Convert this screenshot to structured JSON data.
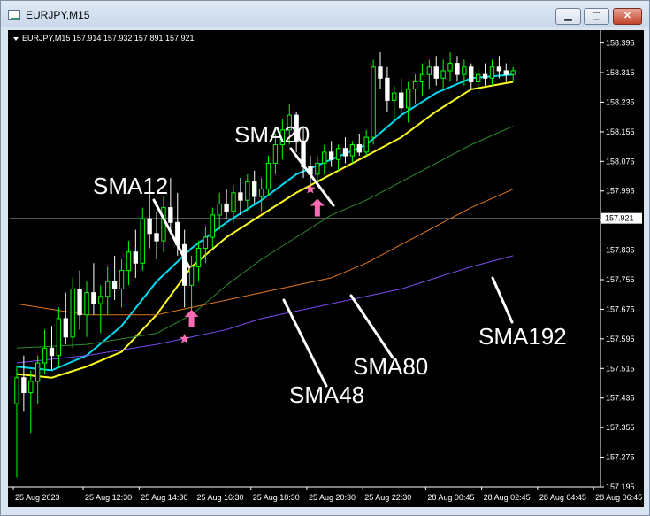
{
  "window": {
    "title": "EURJPY,M15",
    "buttons": {
      "minimize": "▁",
      "maximize": "▢",
      "close": "✕"
    }
  },
  "chart_header": "EURJPY,M15  157.914 157.932 157.891 157.921",
  "colors": {
    "background": "#000000",
    "bull_candle": "#00ff00",
    "bear_candle": "#ffffff",
    "sma12": "#00d8f0",
    "sma20": "#ffff20",
    "sma48": "#2e8b2e",
    "sma80": "#e07820",
    "sma192": "#7a4cf0",
    "arrow": "#ff6ab4",
    "annotation": "#ffffff"
  },
  "chart_data": {
    "type": "candlestick",
    "symbol": "EURJPY",
    "timeframe": "M15",
    "ohlc_current": {
      "open": 157.914,
      "high": 157.932,
      "low": 157.891,
      "close": 157.921
    },
    "current_price_label": "157.921",
    "ylim": [
      157.195,
      158.43
    ],
    "y_ticks": [
      157.195,
      157.275,
      157.355,
      157.435,
      157.515,
      157.595,
      157.675,
      157.755,
      157.835,
      157.915,
      157.995,
      158.075,
      158.155,
      158.235,
      158.315,
      158.395
    ],
    "x_ticks": [
      {
        "label": "25 Aug 2023",
        "bar": 0
      },
      {
        "label": "25 Aug 12:30",
        "bar": 10
      },
      {
        "label": "25 Aug 14:30",
        "bar": 18
      },
      {
        "label": "25 Aug 16:30",
        "bar": 26
      },
      {
        "label": "25 Aug 18:30",
        "bar": 34
      },
      {
        "label": "25 Aug 20:30",
        "bar": 42
      },
      {
        "label": "25 Aug 22:30",
        "bar": 50
      },
      {
        "label": "28 Aug 00:45",
        "bar": 59
      },
      {
        "label": "28 Aug 02:45",
        "bar": 67
      },
      {
        "label": "28 Aug 04:45",
        "bar": 75
      },
      {
        "label": "28 Aug 06:45",
        "bar": 83
      }
    ],
    "candles": [
      [
        157.42,
        157.52,
        157.22,
        157.49
      ],
      [
        157.49,
        157.55,
        157.4,
        157.45
      ],
      [
        157.45,
        157.51,
        157.34,
        157.48
      ],
      [
        157.48,
        157.55,
        157.42,
        157.53
      ],
      [
        157.53,
        157.62,
        157.5,
        157.57
      ],
      [
        157.57,
        157.63,
        157.51,
        157.55
      ],
      [
        157.55,
        157.68,
        157.52,
        157.65
      ],
      [
        157.65,
        157.72,
        157.58,
        157.6
      ],
      [
        157.6,
        157.76,
        157.57,
        157.73
      ],
      [
        157.73,
        157.78,
        157.62,
        157.66
      ],
      [
        157.66,
        157.75,
        157.6,
        157.72
      ],
      [
        157.72,
        157.8,
        157.66,
        157.69
      ],
      [
        157.69,
        157.74,
        157.61,
        157.71
      ],
      [
        157.71,
        157.79,
        157.66,
        157.75
      ],
      [
        157.75,
        157.82,
        157.7,
        157.73
      ],
      [
        157.73,
        157.81,
        157.68,
        157.78
      ],
      [
        157.78,
        157.86,
        157.74,
        157.83
      ],
      [
        157.83,
        157.89,
        157.76,
        157.8
      ],
      [
        157.8,
        157.95,
        157.78,
        157.92
      ],
      [
        157.92,
        158.0,
        157.84,
        157.88
      ],
      [
        157.88,
        157.94,
        157.81,
        157.86
      ],
      [
        157.86,
        157.98,
        157.83,
        157.95
      ],
      [
        157.95,
        158.03,
        157.88,
        157.91
      ],
      [
        157.91,
        157.99,
        157.82,
        157.85
      ],
      [
        157.85,
        157.89,
        157.68,
        157.74
      ],
      [
        157.74,
        157.82,
        157.67,
        157.79
      ],
      [
        157.79,
        157.86,
        157.75,
        157.84
      ],
      [
        157.84,
        157.9,
        157.8,
        157.87
      ],
      [
        157.87,
        157.95,
        157.84,
        157.93
      ],
      [
        157.93,
        157.99,
        157.89,
        157.96
      ],
      [
        157.96,
        158.0,
        157.92,
        157.94
      ],
      [
        157.94,
        158.01,
        157.91,
        157.99
      ],
      [
        157.99,
        158.03,
        157.93,
        157.97
      ],
      [
        157.97,
        158.04,
        157.94,
        158.02
      ],
      [
        158.02,
        158.05,
        157.96,
        157.98
      ],
      [
        157.98,
        158.03,
        157.94,
        158.0
      ],
      [
        158.0,
        158.09,
        157.98,
        158.07
      ],
      [
        158.07,
        158.15,
        158.04,
        158.12
      ],
      [
        158.12,
        158.19,
        158.08,
        158.16
      ],
      [
        158.16,
        158.23,
        158.12,
        158.2
      ],
      [
        158.2,
        158.21,
        158.1,
        158.13
      ],
      [
        158.13,
        158.17,
        158.03,
        158.06
      ],
      [
        158.06,
        158.09,
        158.01,
        158.04
      ],
      [
        158.04,
        158.09,
        158.02,
        158.07
      ],
      [
        158.07,
        158.12,
        158.04,
        158.1
      ],
      [
        158.1,
        158.13,
        158.06,
        158.08
      ],
      [
        158.08,
        158.12,
        158.05,
        158.11
      ],
      [
        158.11,
        158.14,
        158.07,
        158.09
      ],
      [
        158.09,
        158.13,
        158.07,
        158.12
      ],
      [
        158.12,
        158.15,
        158.09,
        158.1
      ],
      [
        158.1,
        158.16,
        158.09,
        158.14
      ],
      [
        158.14,
        158.35,
        158.12,
        158.33
      ],
      [
        158.33,
        158.37,
        158.27,
        158.3
      ],
      [
        158.3,
        158.33,
        158.21,
        158.24
      ],
      [
        158.24,
        158.28,
        158.19,
        158.26
      ],
      [
        158.26,
        158.3,
        158.2,
        158.22
      ],
      [
        158.22,
        158.29,
        158.18,
        158.27
      ],
      [
        158.27,
        158.31,
        158.23,
        158.29
      ],
      [
        158.29,
        158.34,
        158.25,
        158.31
      ],
      [
        158.31,
        158.35,
        158.27,
        158.33
      ],
      [
        158.33,
        158.36,
        158.28,
        158.3
      ],
      [
        158.3,
        158.35,
        158.27,
        158.32
      ],
      [
        158.32,
        158.37,
        158.29,
        158.34
      ],
      [
        158.34,
        158.36,
        158.29,
        158.31
      ],
      [
        158.31,
        158.35,
        158.28,
        158.33
      ],
      [
        158.33,
        158.34,
        158.27,
        158.29
      ],
      [
        158.29,
        158.33,
        158.26,
        158.31
      ],
      [
        158.31,
        158.34,
        158.28,
        158.3
      ],
      [
        158.3,
        158.35,
        158.28,
        158.33
      ],
      [
        158.33,
        158.36,
        158.3,
        158.32
      ],
      [
        158.32,
        158.34,
        158.29,
        158.31
      ],
      [
        158.31,
        158.33,
        158.29,
        158.32
      ]
    ],
    "moving_averages": [
      {
        "name": "SMA12",
        "color": "#00d8f0",
        "values": [
          [
            0,
            157.52
          ],
          [
            5,
            157.51
          ],
          [
            10,
            157.55
          ],
          [
            15,
            157.63
          ],
          [
            20,
            157.75
          ],
          [
            25,
            157.84
          ],
          [
            30,
            157.91
          ],
          [
            35,
            157.97
          ],
          [
            40,
            158.04
          ],
          [
            45,
            158.08
          ],
          [
            50,
            158.12
          ],
          [
            55,
            158.2
          ],
          [
            60,
            158.26
          ],
          [
            65,
            158.3
          ],
          [
            71,
            158.31
          ]
        ]
      },
      {
        "name": "SMA20",
        "color": "#ffff20",
        "values": [
          [
            0,
            157.5
          ],
          [
            5,
            157.49
          ],
          [
            10,
            157.52
          ],
          [
            15,
            157.56
          ],
          [
            20,
            157.66
          ],
          [
            25,
            157.79
          ],
          [
            30,
            157.87
          ],
          [
            35,
            157.93
          ],
          [
            40,
            157.99
          ],
          [
            45,
            158.04
          ],
          [
            50,
            158.09
          ],
          [
            55,
            158.14
          ],
          [
            60,
            158.21
          ],
          [
            65,
            158.27
          ],
          [
            71,
            158.29
          ]
        ]
      },
      {
        "name": "SMA48",
        "color": "#2e8b2e",
        "values": [
          [
            0,
            157.57
          ],
          [
            10,
            157.58
          ],
          [
            20,
            157.61
          ],
          [
            25,
            157.66
          ],
          [
            30,
            157.74
          ],
          [
            35,
            157.81
          ],
          [
            40,
            157.87
          ],
          [
            45,
            157.93
          ],
          [
            50,
            157.97
          ],
          [
            55,
            158.02
          ],
          [
            60,
            158.07
          ],
          [
            65,
            158.12
          ],
          [
            71,
            158.17
          ]
        ]
      },
      {
        "name": "SMA80",
        "color": "#e07820",
        "values": [
          [
            0,
            157.69
          ],
          [
            10,
            157.66
          ],
          [
            20,
            157.66
          ],
          [
            25,
            157.68
          ],
          [
            30,
            157.7
          ],
          [
            35,
            157.72
          ],
          [
            40,
            157.74
          ],
          [
            45,
            157.76
          ],
          [
            50,
            157.8
          ],
          [
            55,
            157.85
          ],
          [
            60,
            157.9
          ],
          [
            65,
            157.95
          ],
          [
            71,
            158.0
          ]
        ]
      },
      {
        "name": "SMA192",
        "color": "#7a4cf0",
        "values": [
          [
            0,
            157.53
          ],
          [
            10,
            157.55
          ],
          [
            20,
            157.58
          ],
          [
            25,
            157.6
          ],
          [
            30,
            157.62
          ],
          [
            35,
            157.65
          ],
          [
            40,
            157.67
          ],
          [
            45,
            157.69
          ],
          [
            50,
            157.71
          ],
          [
            55,
            157.73
          ],
          [
            60,
            157.76
          ],
          [
            65,
            157.79
          ],
          [
            71,
            157.82
          ]
        ]
      }
    ],
    "annotations": [
      {
        "text": "SMA12",
        "points_to": "SMA12"
      },
      {
        "text": "SMA20",
        "points_to": "SMA20"
      },
      {
        "text": "SMA48",
        "points_to": "SMA48"
      },
      {
        "text": "SMA80",
        "points_to": "SMA80"
      },
      {
        "text": "SMA192",
        "points_to": "SMA192"
      }
    ],
    "markers": [
      {
        "type": "star",
        "bar": 24,
        "price": 157.595
      },
      {
        "type": "arrow-up",
        "bar": 25,
        "price": 157.65
      },
      {
        "type": "star",
        "bar": 42,
        "price": 158.0
      },
      {
        "type": "arrow-up",
        "bar": 43,
        "price": 157.95
      }
    ]
  }
}
